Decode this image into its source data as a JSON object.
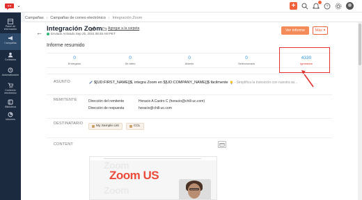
{
  "topbar": {
    "actions": [
      "plus-icon",
      "search-icon",
      "bell-icon",
      "help-icon",
      "gear-icon",
      "avatar"
    ],
    "accent": "#f0623a"
  },
  "breadcrumb": {
    "items": [
      "Campañas",
      "Campañas de correo electrónico",
      "Integración Zoom"
    ]
  },
  "sidebar": {
    "items": [
      {
        "label": "Panel de información",
        "icon": "dashboard-icon"
      },
      {
        "label": "Campañas",
        "icon": "megaphone-icon",
        "active": true
      },
      {
        "label": "Contactos",
        "icon": "contacts-icon"
      },
      {
        "label": "Automatización",
        "icon": "automation-icon"
      },
      {
        "label": "Comercio electrónico",
        "icon": "cart-icon"
      },
      {
        "label": "Biblioteca",
        "icon": "library-icon"
      },
      {
        "label": "Informes",
        "icon": "reports-icon"
      }
    ]
  },
  "header": {
    "title": "Integración Zoom",
    "add_folder": "Agregar a la carpeta",
    "sent_status": "Enviado Activado Sep 25, 2024 08:45 AM PET",
    "view_report": "Ver informe",
    "more": "Más ▾"
  },
  "summary": {
    "title": "Informe resumido",
    "stats": [
      {
        "value": "0",
        "label": "Entregado"
      },
      {
        "value": "0",
        "label": "Se abrió"
      },
      {
        "value": "0",
        "label": "Abierto"
      },
      {
        "value": "0",
        "label": "Seleccionado"
      },
      {
        "value": "4330",
        "label": "Ignorados"
      }
    ]
  },
  "subject": {
    "label": "ASUNTO",
    "text": "$[UD:FIRST_NAME|]$, integra Zoom en $[UD:COMPANY_NAME|]$ fácilmente",
    "preview": "- Simplifica la transición con nuestra as..."
  },
  "sender": {
    "label": "REMITENTE",
    "from_label": "Dirección del remitente",
    "from_value": "Horacio A Castro C (horacio@chill-uc.com)",
    "reply_label": "Dirección de respuesta",
    "reply_value": "horacio@chill-uc.com"
  },
  "recipient": {
    "label": "DESTINATARIO",
    "chips": [
      "My Sample List",
      "CCL"
    ]
  },
  "content": {
    "label": "CONTENT",
    "preview_heading": "Zoom US",
    "ghost_text": "Zoom"
  }
}
